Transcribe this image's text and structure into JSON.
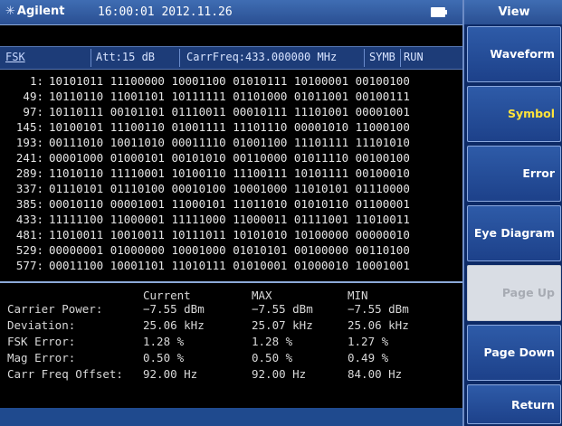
{
  "titlebar": {
    "brand": "Agilent",
    "datetime": "16:00:01 2012.11.26"
  },
  "status": {
    "mode": "FSK",
    "attenuation": "Att:15 dB",
    "carrier_freq": "CarrFreq:433.000000 MHz",
    "symb": "SYMB",
    "run": "RUN"
  },
  "symbols": [
    {
      "idx": "1:",
      "bits": "10101011 11100000 10001100 01010111 10100001 00100100"
    },
    {
      "idx": "49:",
      "bits": "10110110 11001101 10111111 01101000 01011001 00100111"
    },
    {
      "idx": "97:",
      "bits": "10110111 00101101 01110011 00010111 11101001 00001001"
    },
    {
      "idx": "145:",
      "bits": "10100101 11100110 01001111 11101110 00001010 11000100"
    },
    {
      "idx": "193:",
      "bits": "00111010 10011010 00011110 01001100 11101111 11101010"
    },
    {
      "idx": "241:",
      "bits": "00001000 01000101 00101010 00110000 01011110 00100100"
    },
    {
      "idx": "289:",
      "bits": "11010110 11110001 10100110 11100111 10101111 00100010"
    },
    {
      "idx": "337:",
      "bits": "01110101 01110100 00010100 10001000 11010101 01110000"
    },
    {
      "idx": "385:",
      "bits": "00010110 00001001 11000101 11011010 01010110 01100001"
    },
    {
      "idx": "433:",
      "bits": "11111100 11000001 11111000 11000011 01111001 11010011"
    },
    {
      "idx": "481:",
      "bits": "11010011 10010011 10111011 10101010 10100000 00000010"
    },
    {
      "idx": "529:",
      "bits": "00000001 01000000 10001000 01010101 00100000 00110100"
    },
    {
      "idx": "577:",
      "bits": "00011100 10001101 11010111 01010001 01000010 10001001"
    }
  ],
  "measurements": {
    "headers": {
      "current": "Current",
      "max": "MAX",
      "min": "MIN"
    },
    "rows": [
      {
        "label": "Carrier Power:",
        "current": "−7.55 dBm",
        "max": "−7.55 dBm",
        "min": "−7.55 dBm"
      },
      {
        "label": "Deviation:",
        "current": "25.06 kHz",
        "max": "25.07 kHz",
        "min": "25.06 kHz"
      },
      {
        "label": "FSK Error:",
        "current": "1.28 %",
        "max": "1.28 %",
        "min": "1.27 %"
      },
      {
        "label": "Mag Error:",
        "current": "0.50 %",
        "max": "0.50 %",
        "min": "0.49 %"
      },
      {
        "label": "Carr Freq Offset:",
        "current": "92.00 Hz",
        "max": "92.00 Hz",
        "min": "84.00 Hz"
      }
    ]
  },
  "panel": {
    "title": "View",
    "softkeys": [
      {
        "label": "Waveform",
        "state": "normal"
      },
      {
        "label": "Symbol",
        "state": "active"
      },
      {
        "label": "Error",
        "state": "normal"
      },
      {
        "label": "Eye Diagram",
        "state": "normal"
      },
      {
        "label": "Page Up",
        "state": "disabled"
      },
      {
        "label": "Page Down",
        "state": "normal"
      },
      {
        "label": "Return",
        "state": "normal"
      }
    ]
  }
}
